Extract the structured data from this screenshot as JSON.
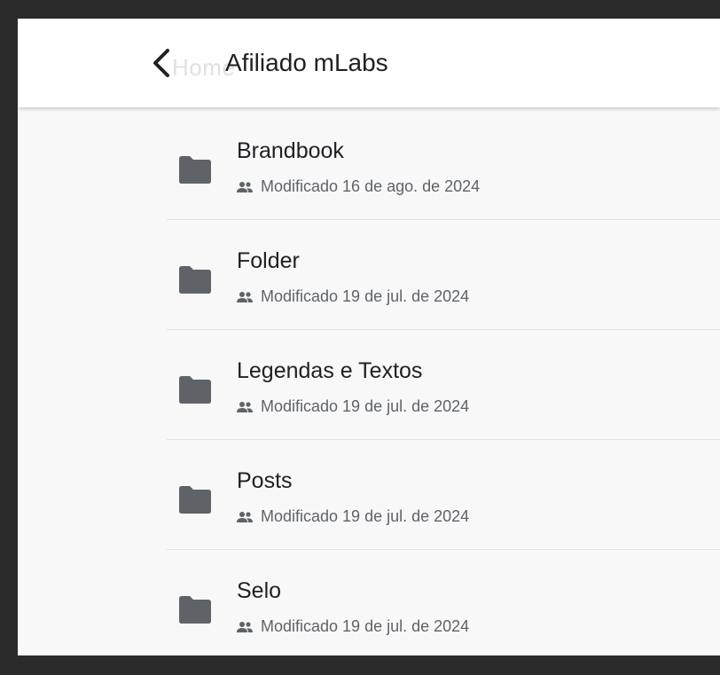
{
  "app_bar": {
    "back_icon": "chevron-left-icon",
    "ghost_text": "Home",
    "title": "Afiliado mLabs"
  },
  "colors": {
    "app_bar_bg": "#ffffff",
    "list_bg": "#f8f8f8",
    "folder_icon": "#5f6368",
    "text_primary": "#202124",
    "text_secondary": "#5f6368",
    "frame_border": "#2b2b2b"
  },
  "folders": [
    {
      "name": "Brandbook",
      "icon": "folder-icon",
      "shared_icon": "people-icon",
      "modified": "Modificado 16 de ago. de 2024"
    },
    {
      "name": "Folder",
      "icon": "folder-icon",
      "shared_icon": "people-icon",
      "modified": "Modificado 19 de jul. de 2024"
    },
    {
      "name": "Legendas e Textos",
      "icon": "folder-icon",
      "shared_icon": "people-icon",
      "modified": "Modificado 19 de jul. de 2024"
    },
    {
      "name": "Posts",
      "icon": "folder-icon",
      "shared_icon": "people-icon",
      "modified": "Modificado 19 de jul. de 2024"
    },
    {
      "name": "Selo",
      "icon": "folder-icon",
      "shared_icon": "people-icon",
      "modified": "Modificado 19 de jul. de 2024"
    }
  ]
}
